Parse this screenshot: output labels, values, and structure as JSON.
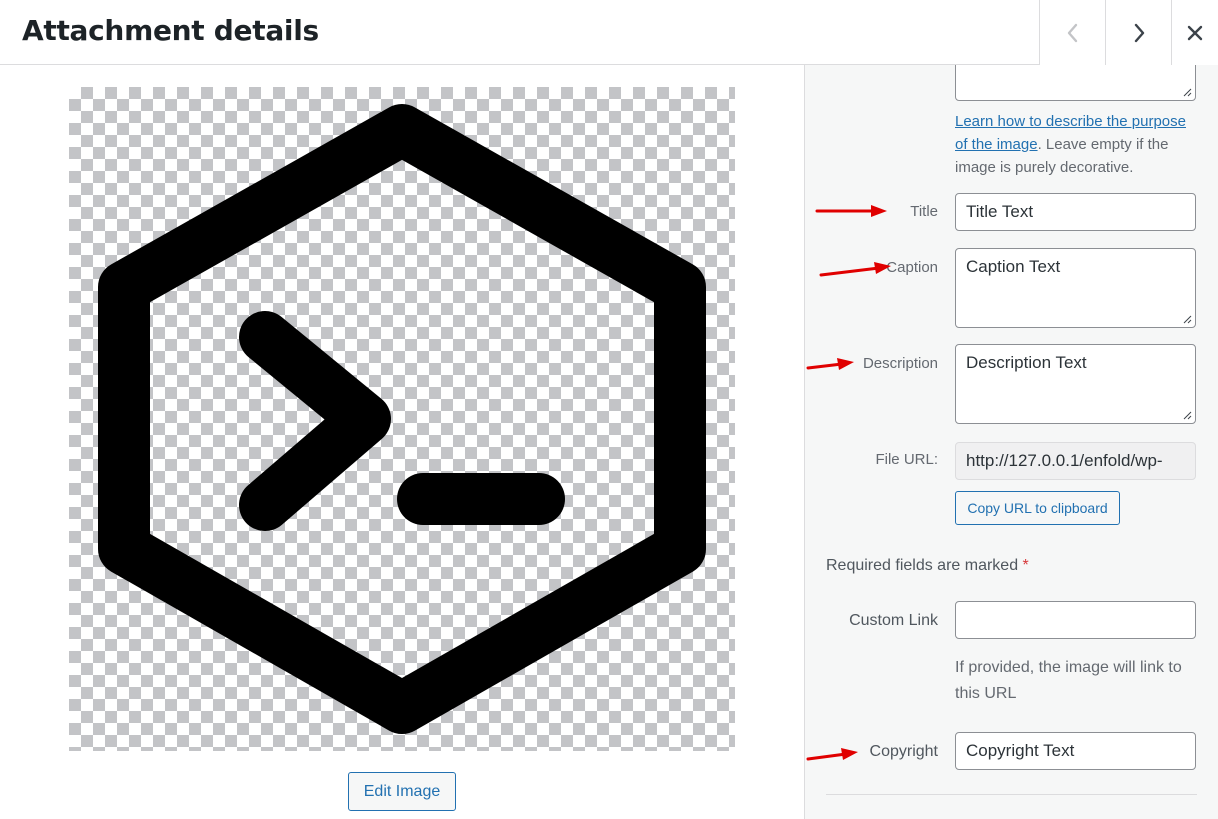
{
  "header": {
    "title": "Attachment details",
    "prev_icon": "chevron-left-icon",
    "next_icon": "chevron-right-icon",
    "close_icon": "close-icon"
  },
  "preview": {
    "edit_button_label": "Edit Image",
    "image_icon": "terminal-hexagon-icon"
  },
  "details": {
    "alt_text": {
      "value": ""
    },
    "alt_help": {
      "link_text": "Learn how to describe the purpose of the image",
      "suffix": ". Leave empty if the image is purely decorative."
    },
    "title": {
      "label": "Title",
      "value": "Title Text"
    },
    "caption": {
      "label": "Caption",
      "value": "Caption Text"
    },
    "description": {
      "label": "Description",
      "value": "Description Text"
    },
    "file_url": {
      "label": "File URL:",
      "value": "http://127.0.0.1/enfold/wp-"
    },
    "copy_button_label": "Copy URL to clipboard",
    "required_note": "Required fields are marked",
    "required_star": "*",
    "custom_link": {
      "label": "Custom Link",
      "value": "",
      "help": "If provided, the image will link to this URL"
    },
    "copyright": {
      "label": "Copyright",
      "value": "Copyright Text"
    }
  },
  "colors": {
    "accent": "#2271b1",
    "annotation_arrow": "#e00000",
    "required": "#d63638",
    "panel_bg": "#f6f7f7"
  }
}
